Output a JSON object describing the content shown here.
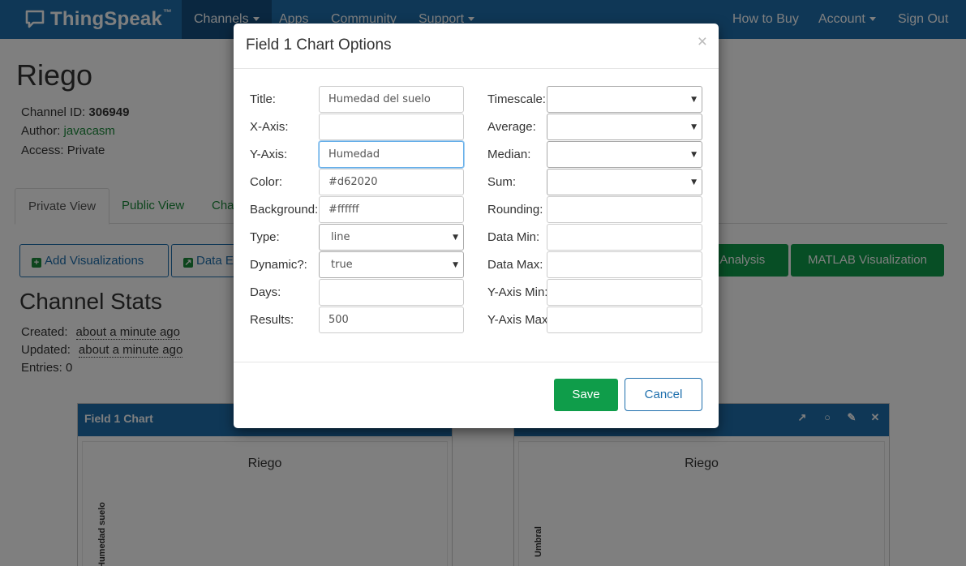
{
  "nav": {
    "brand": "ThingSpeak",
    "trademark": "™",
    "items": [
      "Channels",
      "Apps",
      "Community",
      "Support"
    ],
    "right_items": [
      "How to Buy",
      "Account",
      "Sign Out"
    ]
  },
  "channel": {
    "title": "Riego",
    "id_label": "Channel ID:",
    "id_value": "306949",
    "author_label": "Author:",
    "author_value": "javacasm",
    "access_label": "Access:",
    "access_value": "Private"
  },
  "tabs": [
    "Private View",
    "Public View",
    "Cha"
  ],
  "actions": {
    "add_visualizations": "Add Visualizations",
    "data_export": "Data E",
    "analysis": "B Analysis",
    "matlab_visualization": "MATLAB Visualization"
  },
  "stats": {
    "title": "Channel Stats",
    "created_label": "Created:",
    "created_value": "about a minute ago",
    "updated_label": "Updated:",
    "updated_value": "about a minute ago",
    "entries_label": "Entries:",
    "entries_value": "0"
  },
  "charts": [
    {
      "header": "Field 1 Chart",
      "title": "Riego",
      "ylabel": "Humedad suelo"
    },
    {
      "header": "",
      "title": "Riego",
      "ylabel": "Umbral"
    }
  ],
  "modal": {
    "title": "Field 1 Chart Options",
    "close": "×",
    "left_fields": {
      "title": {
        "label": "Title:",
        "value": "Humedad del suelo"
      },
      "xaxis": {
        "label": "X-Axis:",
        "value": ""
      },
      "yaxis": {
        "label": "Y-Axis:",
        "value": "Humedad"
      },
      "color": {
        "label": "Color:",
        "value": "#d62020"
      },
      "background": {
        "label": "Background:",
        "value": "#ffffff"
      },
      "type": {
        "label": "Type:",
        "value": "line"
      },
      "dynamic": {
        "label": "Dynamic?:",
        "value": "true"
      },
      "days": {
        "label": "Days:",
        "value": ""
      },
      "results": {
        "label": "Results:",
        "value": "500"
      }
    },
    "right_fields": {
      "timescale": {
        "label": "Timescale:",
        "value": ""
      },
      "average": {
        "label": "Average:",
        "value": ""
      },
      "median": {
        "label": "Median:",
        "value": ""
      },
      "sum": {
        "label": "Sum:",
        "value": ""
      },
      "rounding": {
        "label": "Rounding:",
        "value": ""
      },
      "data_min": {
        "label": "Data Min:",
        "value": ""
      },
      "data_max": {
        "label": "Data Max:",
        "value": ""
      },
      "yaxis_min": {
        "label": "Y-Axis Min:",
        "value": ""
      },
      "yaxis_max": {
        "label": "Y-Axis Max:",
        "value": ""
      }
    },
    "save": "Save",
    "cancel": "Cancel"
  },
  "colors": {
    "nav_blue": "#1e6fad",
    "brand_green": "#0f9d4a",
    "link_green": "#1b8a3a"
  }
}
